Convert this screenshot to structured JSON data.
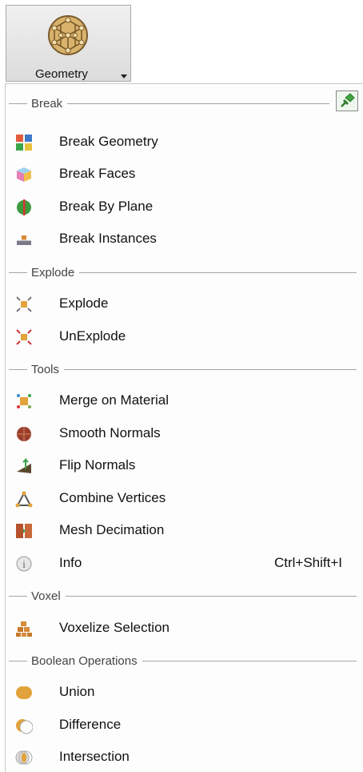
{
  "ribbon": {
    "label": "Geometry"
  },
  "sections": [
    {
      "title": "Break"
    },
    {
      "title": "Explode"
    },
    {
      "title": "Tools"
    },
    {
      "title": "Voxel"
    },
    {
      "title": "Boolean Operations"
    }
  ],
  "items": [
    {
      "label": "Break Geometry"
    },
    {
      "label": "Break Faces"
    },
    {
      "label": "Break By Plane"
    },
    {
      "label": "Break Instances"
    },
    {
      "label": "Explode"
    },
    {
      "label": "UnExplode"
    },
    {
      "label": "Merge on Material"
    },
    {
      "label": "Smooth Normals"
    },
    {
      "label": "Flip Normals"
    },
    {
      "label": "Combine Vertices"
    },
    {
      "label": "Mesh Decimation"
    },
    {
      "label": "Info",
      "shortcut": "Ctrl+Shift+I"
    },
    {
      "label": "Voxelize Selection"
    },
    {
      "label": "Union"
    },
    {
      "label": "Difference"
    },
    {
      "label": "Intersection"
    }
  ],
  "colors": {
    "menu_bg": "#fdfdfd",
    "separator": "#a5a5a5",
    "pin": "#3fa33f"
  }
}
